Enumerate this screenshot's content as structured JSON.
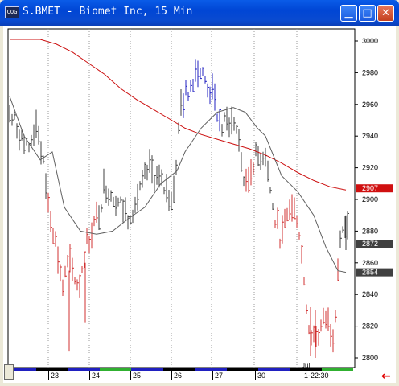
{
  "window": {
    "title": "S.BMET - Biomet Inc, 15 Min",
    "icon_label": "CQG",
    "icon_names": [
      "app-icon",
      "minimize-icon",
      "maximize-icon",
      "close-icon",
      "scroll-left-arrow-icon"
    ],
    "minimize_glyph": "▁",
    "maximize_glyph": "□",
    "close_glyph": "✕",
    "left_arrow_glyph": "←"
  },
  "colors": {
    "up_bar": "#404040",
    "down_bar": "#d03030",
    "high_bar": "#2020c0",
    "ma_long": "#cc1010",
    "ma_short": "#606060",
    "price_tag_red": "#d01010",
    "price_tag_dark": "#404040"
  },
  "chart_data": {
    "type": "bar",
    "ylim": [
      2795,
      3010
    ],
    "yticks": [
      2800,
      2820,
      2840,
      2860,
      2880,
      2900,
      2920,
      2940,
      2960,
      2980,
      3000
    ],
    "date_labels": [
      "23",
      "24",
      "25",
      "26",
      "27",
      "30",
      "1-22:30"
    ],
    "month_label": "Jul",
    "price_labels": [
      {
        "value": 2907,
        "text": "2907",
        "color": "red"
      },
      {
        "value": 2872,
        "text": "2872",
        "color": "dark"
      },
      {
        "value": 2854,
        "text": "2854",
        "color": "dark"
      }
    ],
    "session_colors": [
      "#2020c0",
      "#000000",
      "#2020c0",
      "#30b030",
      "#2020c0",
      "#000000",
      "#2020c0",
      "#000000",
      "#2020c0",
      "#000000",
      "#30b030"
    ],
    "anchors": [
      [
        0,
        2955,
        "u"
      ],
      [
        12,
        2945,
        "u"
      ],
      [
        24,
        2930,
        "u"
      ],
      [
        36,
        2950,
        "u"
      ],
      [
        48,
        2905,
        "d"
      ],
      [
        60,
        2870,
        "d"
      ],
      [
        68,
        2845,
        "d"
      ],
      [
        75,
        2860,
        "d"
      ],
      [
        88,
        2845,
        "d"
      ],
      [
        96,
        2870,
        "d"
      ],
      [
        104,
        2880,
        "d"
      ],
      [
        112,
        2890,
        "u"
      ],
      [
        120,
        2910,
        "u"
      ],
      [
        135,
        2900,
        "u"
      ],
      [
        150,
        2890,
        "u"
      ],
      [
        165,
        2905,
        "u"
      ],
      [
        175,
        2920,
        "u"
      ],
      [
        190,
        2910,
        "u"
      ],
      [
        205,
        2900,
        "u"
      ],
      [
        215,
        2960,
        "h"
      ],
      [
        225,
        2970,
        "h"
      ],
      [
        235,
        2985,
        "h"
      ],
      [
        245,
        2975,
        "h"
      ],
      [
        255,
        2965,
        "h"
      ],
      [
        265,
        2945,
        "u"
      ],
      [
        275,
        2950,
        "u"
      ],
      [
        285,
        2945,
        "u"
      ],
      [
        295,
        2905,
        "d"
      ],
      [
        305,
        2925,
        "u"
      ],
      [
        320,
        2930,
        "u"
      ],
      [
        330,
        2890,
        "d"
      ],
      [
        340,
        2875,
        "d"
      ],
      [
        350,
        2895,
        "d"
      ],
      [
        360,
        2890,
        "d"
      ],
      [
        368,
        2850,
        "d"
      ],
      [
        375,
        2815,
        "d"
      ],
      [
        385,
        2815,
        "d"
      ],
      [
        395,
        2825,
        "d"
      ],
      [
        405,
        2815,
        "d"
      ],
      [
        412,
        2875,
        "u"
      ],
      [
        420,
        2880,
        "u"
      ]
    ],
    "ma_long_points": [
      [
        2,
        3001
      ],
      [
        20,
        3001
      ],
      [
        40,
        3001
      ],
      [
        60,
        2998
      ],
      [
        80,
        2993
      ],
      [
        100,
        2986
      ],
      [
        120,
        2979
      ],
      [
        140,
        2970
      ],
      [
        160,
        2963
      ],
      [
        180,
        2957
      ],
      [
        200,
        2951
      ],
      [
        220,
        2945
      ],
      [
        240,
        2941
      ],
      [
        260,
        2938
      ],
      [
        280,
        2935
      ],
      [
        300,
        2932
      ],
      [
        320,
        2928
      ],
      [
        340,
        2923
      ],
      [
        360,
        2917
      ],
      [
        380,
        2912
      ],
      [
        400,
        2908
      ],
      [
        420,
        2906
      ]
    ],
    "ma_short_points": [
      [
        2,
        2965
      ],
      [
        20,
        2940
      ],
      [
        40,
        2925
      ],
      [
        55,
        2930
      ],
      [
        70,
        2895
      ],
      [
        90,
        2880
      ],
      [
        110,
        2878
      ],
      [
        130,
        2880
      ],
      [
        150,
        2888
      ],
      [
        170,
        2895
      ],
      [
        190,
        2910
      ],
      [
        210,
        2918
      ],
      [
        220,
        2930
      ],
      [
        240,
        2945
      ],
      [
        260,
        2955
      ],
      [
        280,
        2958
      ],
      [
        295,
        2955
      ],
      [
        310,
        2945
      ],
      [
        320,
        2940
      ],
      [
        340,
        2915
      ],
      [
        360,
        2905
      ],
      [
        380,
        2890
      ],
      [
        395,
        2870
      ],
      [
        410,
        2855
      ],
      [
        420,
        2854
      ]
    ]
  }
}
